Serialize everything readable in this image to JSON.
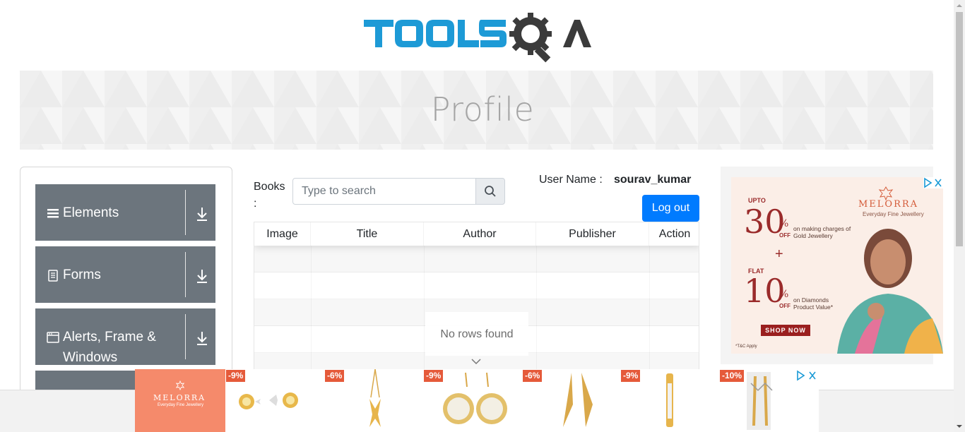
{
  "header": {
    "logo_text": "TOOLSQA"
  },
  "banner": {
    "title": "Profile"
  },
  "sidebar": {
    "groups": [
      {
        "label": "Elements",
        "icon": "hamburger-icon"
      },
      {
        "label": "Forms",
        "icon": "document-icon"
      },
      {
        "label": "Alerts, Frame & Windows",
        "icon": "window-icon"
      }
    ]
  },
  "books": {
    "label": "Books :",
    "search_placeholder": "Type to search"
  },
  "user": {
    "label": "User Name :",
    "value": "sourav_kumar",
    "logout_label": "Log out"
  },
  "table": {
    "columns": [
      "Image",
      "Title",
      "Author",
      "Publisher",
      "Action"
    ],
    "empty_text": "No rows found"
  },
  "ads": {
    "right": {
      "brand": "MELORRA",
      "tagline": "Everyday Fine Jewellery",
      "offer1_prefix": "UPTO",
      "offer1_value": "30",
      "offer1_text": "on making charges of Gold Jewellery",
      "plus": "+",
      "offer2_prefix": "FLAT",
      "offer2_value": "10",
      "offer2_text": "on Diamonds Product Value*",
      "off": "OFF",
      "cta": "SHOP NOW",
      "footnote": "*T&C Apply"
    },
    "bottom": {
      "brand": "MELORRA",
      "tagline": "Everyday Fine Jewellery",
      "discounts": [
        "-9%",
        "-6%",
        "-9%",
        "-6%",
        "-9%",
        "-10%"
      ]
    }
  },
  "colors": {
    "sidebar_bg": "#6c757d",
    "primary": "#007bff",
    "banner_text": "#a4a4a4"
  }
}
